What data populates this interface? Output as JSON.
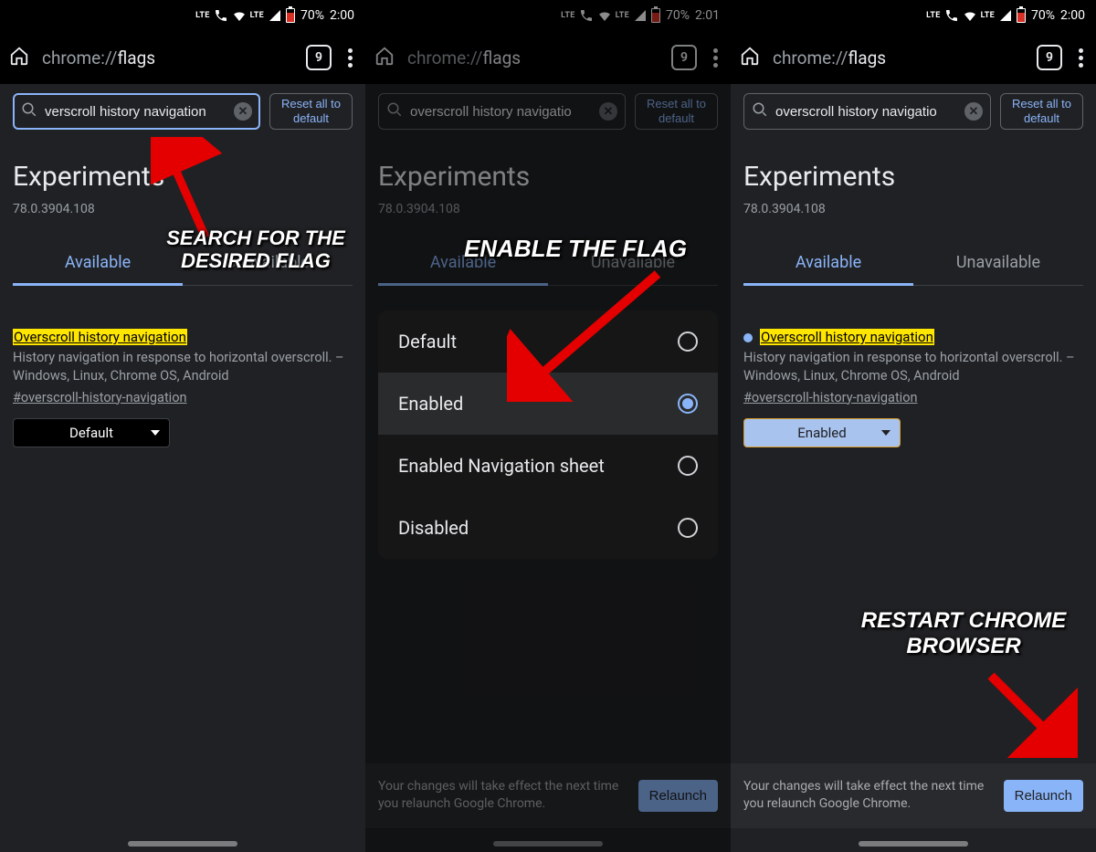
{
  "status": {
    "battery_pct": "70%",
    "lte": "LTE"
  },
  "screens": [
    {
      "time": "2:00",
      "url_prefix": "chrome://",
      "url_bold": "flags",
      "tab_count": "9",
      "search_value": "verscroll history navigation",
      "reset_label": "Reset all to default",
      "experiments_title": "Experiments",
      "version": "78.0.3904.108",
      "tab_available": "Available",
      "tab_unavailable": "Unavailable",
      "flag_title": "Overscroll history navigation",
      "flag_desc": "History navigation in response to horizontal overscroll. – Windows, Linux, Chrome OS, Android",
      "flag_anchor": "#overscroll-history-navigation",
      "select_value": "Default",
      "annotation": "SEARCH FOR THE DESIRED FLAG"
    },
    {
      "time": "2:01",
      "url_prefix": "chrome://",
      "url_bold": "flags",
      "tab_count": "9",
      "search_value": "overscroll history navigatio",
      "reset_label": "Reset all to default",
      "experiments_title": "Experiments",
      "version": "78.0.3904.108",
      "tab_available": "Available",
      "tab_unavailable": "Unavailable",
      "options": [
        {
          "label": "Default",
          "selected": false
        },
        {
          "label": "Enabled",
          "selected": true
        },
        {
          "label": "Enabled Navigation sheet",
          "selected": false
        },
        {
          "label": "Disabled",
          "selected": false
        }
      ],
      "relaunch_text": "Your changes will take effect the next time you relaunch Google Chrome.",
      "relaunch_button": "Relaunch",
      "annotation": "ENABLE THE FLAG"
    },
    {
      "time": "2:00",
      "url_prefix": "chrome://",
      "url_bold": "flags",
      "tab_count": "9",
      "search_value": "overscroll history navigatio",
      "reset_label": "Reset all to default",
      "experiments_title": "Experiments",
      "version": "78.0.3904.108",
      "tab_available": "Available",
      "tab_unavailable": "Unavailable",
      "flag_title": "Overscroll history navigation",
      "flag_desc": "History navigation in response to horizontal overscroll. – Windows, Linux, Chrome OS, Android",
      "flag_anchor": "#overscroll-history-navigation",
      "select_value": "Enabled",
      "relaunch_text": "Your changes will take effect the next time you relaunch Google Chrome.",
      "relaunch_button": "Relaunch",
      "annotation": "RESTART CHROME BROWSER"
    }
  ]
}
